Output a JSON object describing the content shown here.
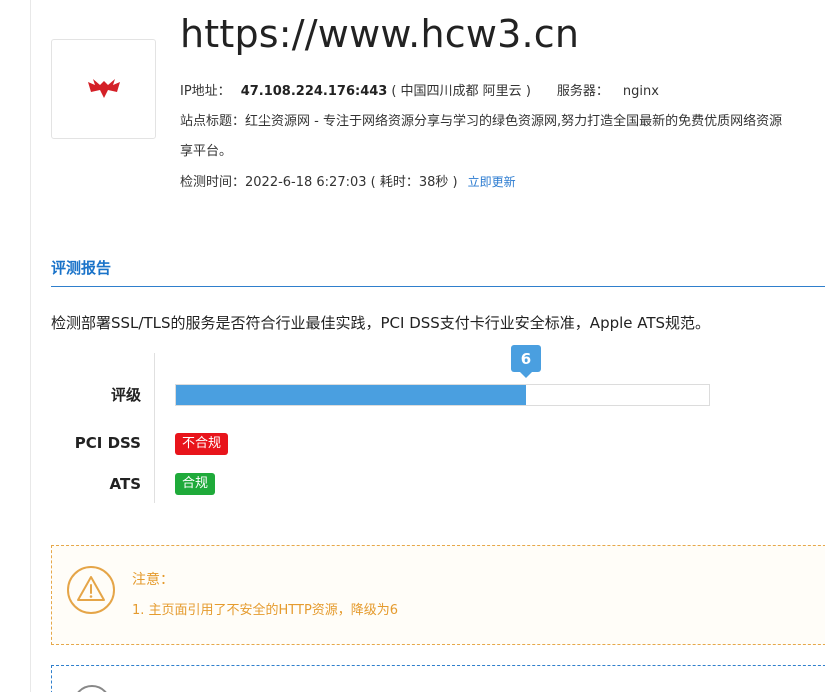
{
  "site": {
    "url": "https://www.hcw3.cn",
    "ip_label": "IP地址：",
    "ip_value": "47.108.224.176:443",
    "ip_location": "( 中国四川成都 阿里云 )",
    "server_label": "服务器：",
    "server_value": "nginx",
    "title_line1": "站点标题：红尘资源网 - 专注于网络资源分享与学习的绿色资源网,努力打造全国最新的免费优质网络资源",
    "title_line2": "享平台。",
    "time_text": "检测时间：2022-6-18 6:27:03 ( 耗时：38秒 )",
    "refresh_label": "立即更新"
  },
  "report": {
    "section_title": "评测报告",
    "description": "检测部署SSL/TLS的服务是否符合行业最佳实践，PCI DSS支付卡行业安全标准，Apple ATS规范。",
    "grade_label": "评级",
    "grade_value": "6",
    "grade_fraction": 0.656,
    "pci_label": "PCI DSS",
    "pci_status": "不合规",
    "ats_label": "ATS",
    "ats_status": "合规"
  },
  "notice": {
    "title": "注意：",
    "items": [
      "1. 主页面引用了不安全的HTTP资源，降级为6"
    ]
  },
  "colors": {
    "accent": "#1a73c9",
    "grade_fill": "#4a9fe0",
    "fail": "#e8141b",
    "pass": "#1faa3a",
    "warning": "#e59b2e"
  }
}
